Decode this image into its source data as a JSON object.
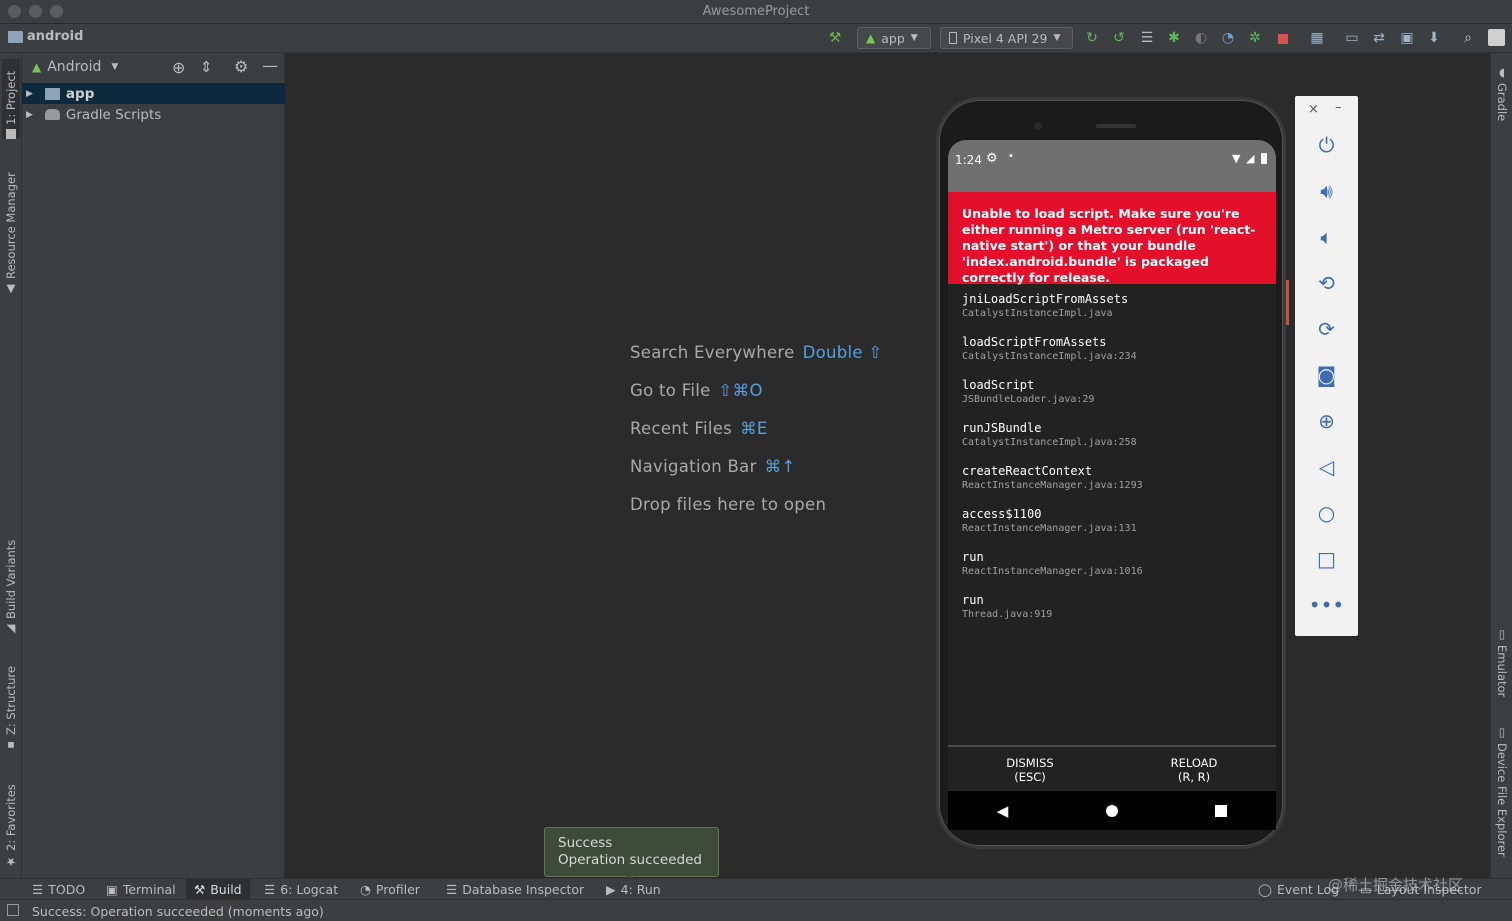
{
  "window": {
    "title": "AwesomeProject"
  },
  "toolbar": {
    "breadcrumb": "android",
    "run_config": "app",
    "device": "Pixel 4 API 29"
  },
  "project_panel": {
    "view_mode": "Android",
    "tree": [
      {
        "label": "app",
        "selected": true
      },
      {
        "label": "Gradle Scripts",
        "selected": false
      }
    ]
  },
  "left_stripe": {
    "project": "1: Project",
    "resource_manager": "Resource Manager",
    "build_variants": "Build Variants",
    "structure": "Z: Structure",
    "favorites": "2: Favorites"
  },
  "right_stripe": {
    "gradle": "Gradle",
    "emulator": "Emulator",
    "device_file_explorer": "Device File Explorer"
  },
  "editor_hints": [
    {
      "label": "Search Everywhere",
      "shortcut": "Double ⇧"
    },
    {
      "label": "Go to File",
      "shortcut": "⇧⌘O"
    },
    {
      "label": "Recent Files",
      "shortcut": "⌘E"
    },
    {
      "label": "Navigation Bar",
      "shortcut": "⌘↑"
    },
    {
      "label": "Drop files here to open",
      "shortcut": ""
    }
  ],
  "device_screen": {
    "time": "1:24",
    "error_message": "Unable to load script. Make sure you're either running a Metro server (run 'react-native start') or that your bundle 'index.android.bundle' is packaged correctly for release.",
    "stack": [
      {
        "method": "jniLoadScriptFromAssets",
        "file": "CatalystInstanceImpl.java"
      },
      {
        "method": "loadScriptFromAssets",
        "file": "CatalystInstanceImpl.java:234"
      },
      {
        "method": "loadScript",
        "file": "JSBundleLoader.java:29"
      },
      {
        "method": "runJSBundle",
        "file": "CatalystInstanceImpl.java:258"
      },
      {
        "method": "createReactContext",
        "file": "ReactInstanceManager.java:1293"
      },
      {
        "method": "access$1100",
        "file": "ReactInstanceManager.java:131"
      },
      {
        "method": "run",
        "file": "ReactInstanceManager.java:1016"
      },
      {
        "method": "run",
        "file": "Thread.java:919"
      }
    ],
    "dismiss_label": "DISMISS",
    "dismiss_key": "(ESC)",
    "reload_label": "RELOAD",
    "reload_key": "(R, R)"
  },
  "notification": {
    "title": "Success",
    "message": "Operation succeeded"
  },
  "tool_windows": {
    "todo": "TODO",
    "terminal": "Terminal",
    "build": "Build",
    "logcat": "6: Logcat",
    "profiler": "Profiler",
    "database_inspector": "Database Inspector",
    "run": "4: Run",
    "event_log": "Event Log",
    "layout_inspector": "Layout Inspector"
  },
  "status_line": "Success: Operation succeeded (moments ago)",
  "watermark": "@稀土掘金技术社区"
}
